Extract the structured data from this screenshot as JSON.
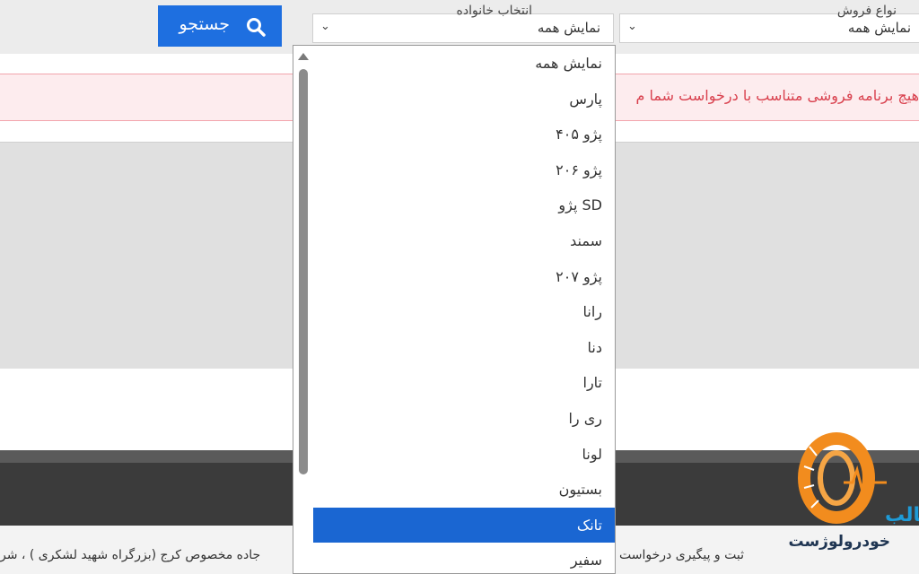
{
  "filters": {
    "sale_type": {
      "label": "نواع فروش",
      "value": "نمایش همه"
    },
    "family": {
      "label": "انتخاب خانواده",
      "value": "نمایش همه"
    }
  },
  "search_button": {
    "label": "جستجو",
    "icon": "search-icon"
  },
  "alert": {
    "text": "هیچ برنامه فروشی متناسب با درخواست شما م",
    "color": "#d9414e"
  },
  "dropdown": {
    "options": [
      "نمایش همه",
      "پارس",
      "پژو ۴۰۵",
      "پژو ۲۰۶",
      "SD پژو",
      "سمند",
      "پژو ۲۰۷",
      "رانا",
      "دنا",
      "تارا",
      "ری را",
      "لونا",
      "بستیون",
      "تانک",
      "سفیر"
    ],
    "highlighted": "تانک"
  },
  "footer": {
    "logo_text": "خودرولوژست",
    "logo_partial": "طالب",
    "left_text": "جاده مخصوص کرج (بزرگراه شهید لشکری ) ، شر",
    "right_text": "ثبت و پیگیری درخواست مشتری"
  },
  "colors": {
    "accent": "#1e6fe0",
    "highlight": "#1a66d2",
    "footer_dark": "#3b3b3b"
  }
}
